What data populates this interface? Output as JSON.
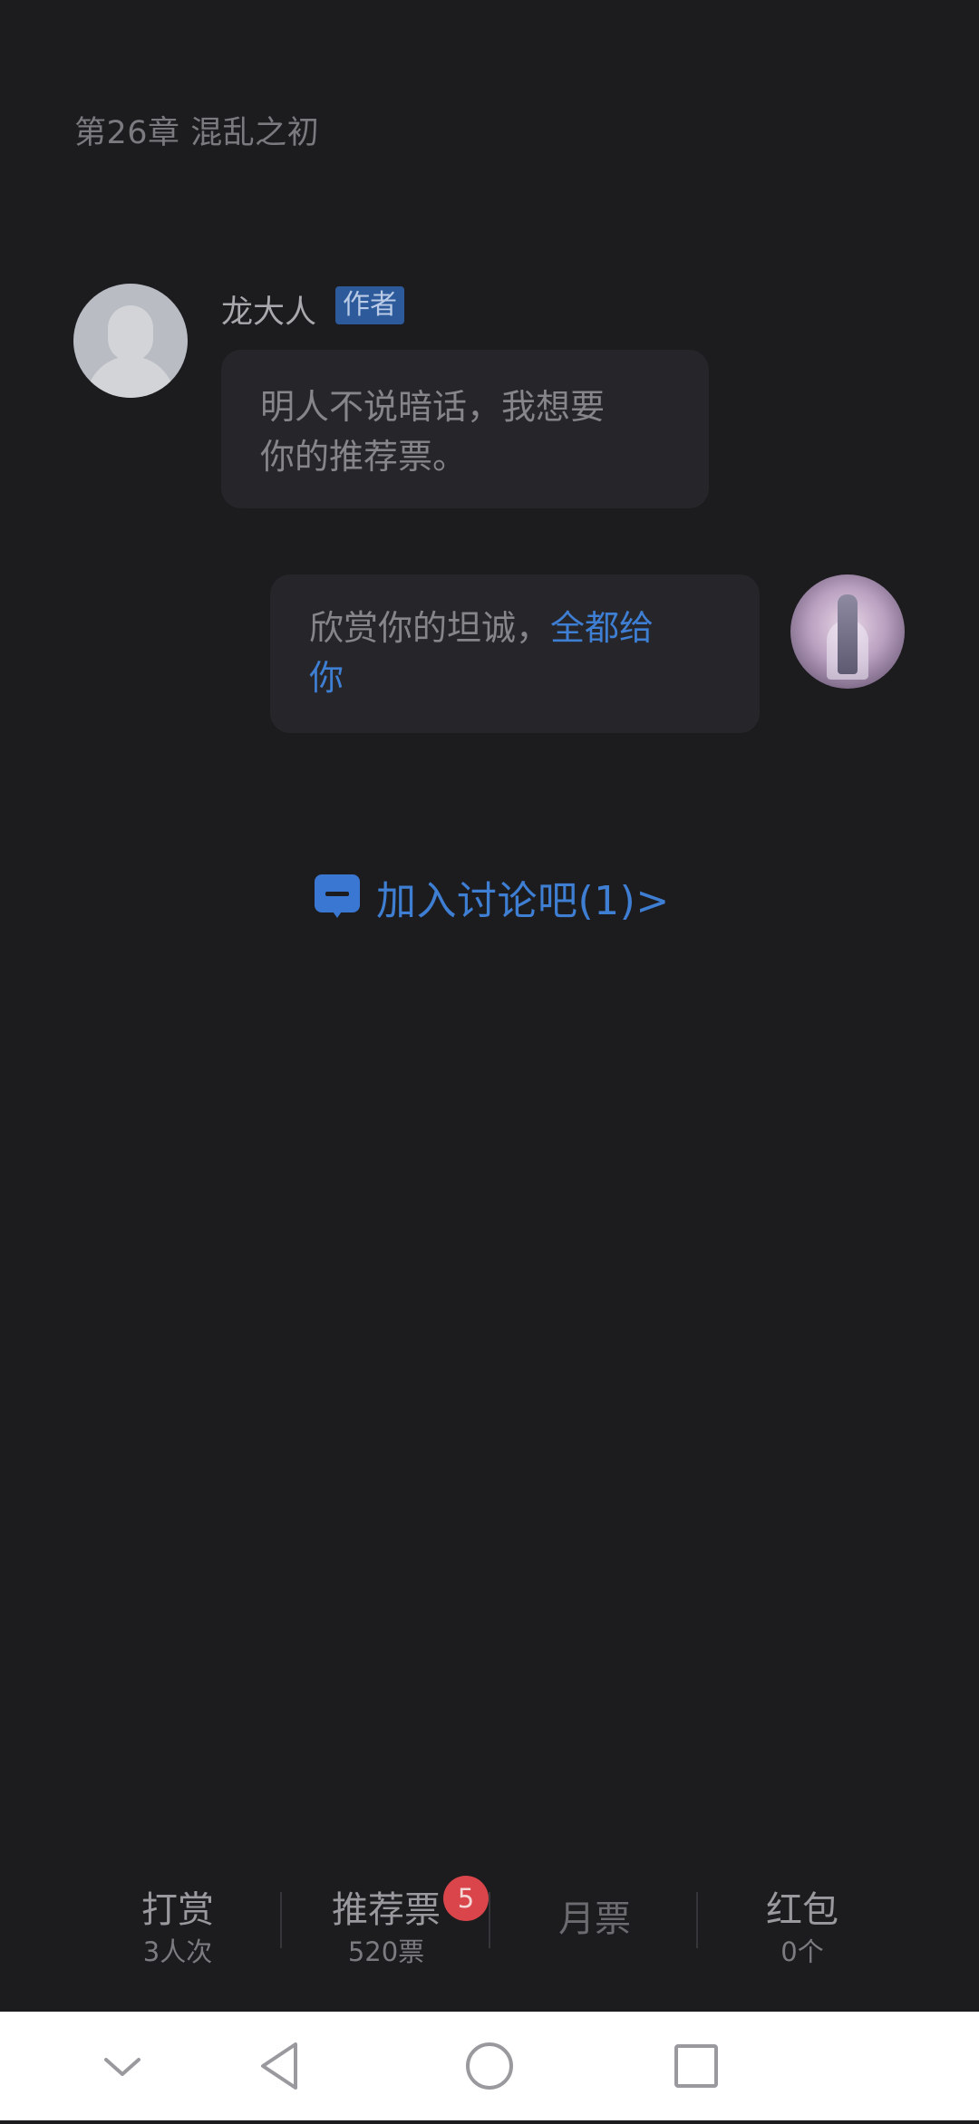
{
  "chapter": {
    "title": "第26章 混乱之初"
  },
  "author_message": {
    "name": "龙大人",
    "badge": "作者",
    "text_line1": "明人不说暗话，我想要",
    "text_line2": "你的推荐票。"
  },
  "reader_reply": {
    "text_plain": "欣赏你的坦诚，",
    "text_highlight_1": "全都给",
    "text_highlight_2": "你"
  },
  "join_discussion": {
    "label": "加入讨论吧(1)>"
  },
  "actions": {
    "reward": {
      "label": "打赏",
      "count": "3人次"
    },
    "recommend": {
      "label": "推荐票",
      "count": "520票",
      "badge": "5"
    },
    "monthly": {
      "label": "月票"
    },
    "red_packet": {
      "label": "红包",
      "count": "0个"
    }
  },
  "colors": {
    "background": "#1c1c1f",
    "accent": "#3e7ed3",
    "badge_red": "#d9454a"
  }
}
